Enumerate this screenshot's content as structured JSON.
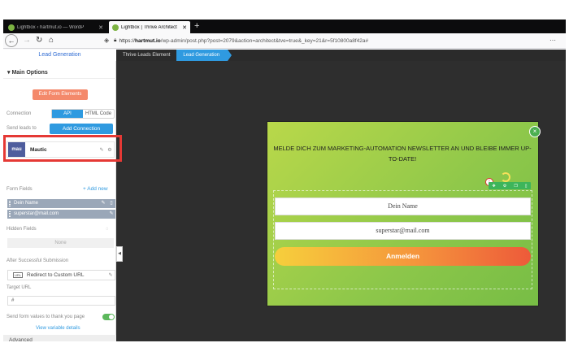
{
  "browser": {
    "tabs": [
      {
        "title": "Lightbox ‹ hartmut.io — WordP",
        "active": false
      },
      {
        "title": "Lightbox | Thrive Architect",
        "active": true
      }
    ],
    "new_tab": "+",
    "url_prefix": "https://",
    "url_host": "hartmut.io",
    "url_rest": "/wp-admin/post.php?post=2079&action=architect&tve=true&_key=21&r=5f10800a8f42a#",
    "menu": "···"
  },
  "editor": {
    "panel_title": "Lead Generation",
    "breadcrumbs": [
      "Thrive Leads Element",
      "Lead Generation"
    ]
  },
  "panel": {
    "main_options": "▾  Main Options",
    "edit_form_elements": "Edit Form Elements",
    "connection_label": "Connection",
    "connection_api": "API",
    "connection_html": "HTML Code",
    "send_leads_label": "Send leads to",
    "add_connection": "Add Connection",
    "service_logo": "mau",
    "service_name": "Mautic",
    "form_fields_label": "Form Fields",
    "add_new": "+  Add new",
    "fields": [
      "Dein Name",
      "superstar@mail.com"
    ],
    "hidden_fields_label": "Hidden Fields",
    "hidden_none": "None",
    "after_submission_label": "After Successful Submission",
    "redirect_label": "Redirect to Custom URL",
    "target_url_label": "Target URL",
    "target_url_value": "#",
    "send_values_label": "Send form values to thank you page",
    "view_variable_details": "View variable details",
    "advanced": "Advanced"
  },
  "popup": {
    "headline": "MELDE DICH ZUM MARKETING-AUTOMATION NEWSLETTER AN UND BLEIBE IMMER UP-TO-DATE!",
    "name_field": "Dein Name",
    "email_field": "superstar@mail.com",
    "submit": "Anmelden",
    "accent_green": "#8dc74a",
    "button_gradient": [
      "#f6cf3c",
      "#f5953c",
      "#ed5a3a"
    ]
  },
  "colors": {
    "accent_blue": "#2f9ae0",
    "highlight_red": "#e53935",
    "edit_button": "#f4896b"
  }
}
